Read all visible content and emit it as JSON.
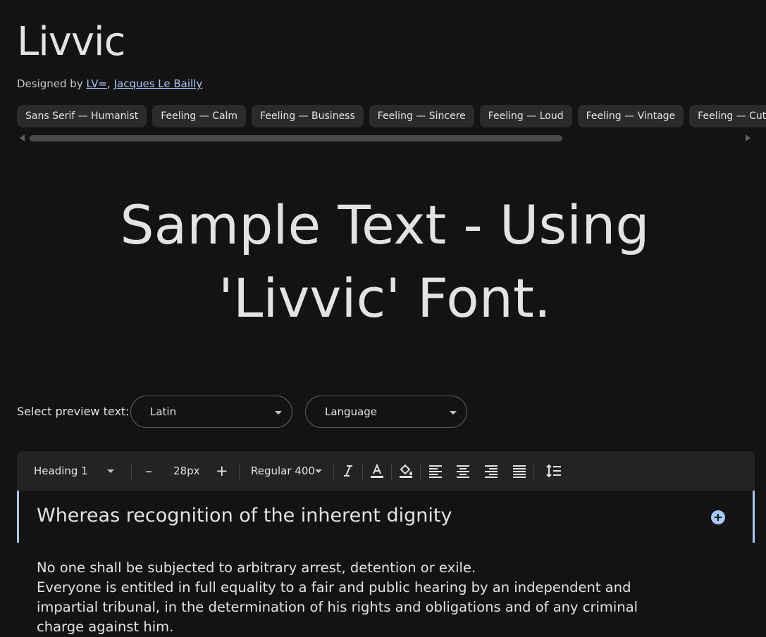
{
  "font_name": "Livvic",
  "designed_by_prefix": "Designed by ",
  "designers": [
    "LV=",
    "Jacques Le Bailly"
  ],
  "designer_separator": ", ",
  "tags": [
    "Sans Serif — Humanist",
    "Feeling — Calm",
    "Feeling — Business",
    "Feeling — Sincere",
    "Feeling — Loud",
    "Feeling — Vintage",
    "Feeling — Cute"
  ],
  "sample_text": "Sample Text - Using 'Livvic' Font.",
  "preview": {
    "label": "Select preview text:",
    "script_value": "Latin",
    "language_value": "Language"
  },
  "toolbar": {
    "style_value": "Heading 1",
    "size_value": "28px",
    "weight_value": "Regular 400",
    "decrease_label": "–",
    "increase_label": "+"
  },
  "editor": {
    "heading": "Whereas recognition of the inherent dignity",
    "paragraph_lines": [
      "No one shall be subjected to arbitrary arrest, detention or exile.",
      "Everyone is entitled in full equality to a fair and public hearing by an independent and",
      "impartial tribunal, in the determination of his rights and obligations and of any criminal",
      "charge against him."
    ]
  },
  "colors": {
    "background": "#131313",
    "accent": "#a8c7fa",
    "chip": "#2b2b2b",
    "toolbar": "#232323"
  }
}
